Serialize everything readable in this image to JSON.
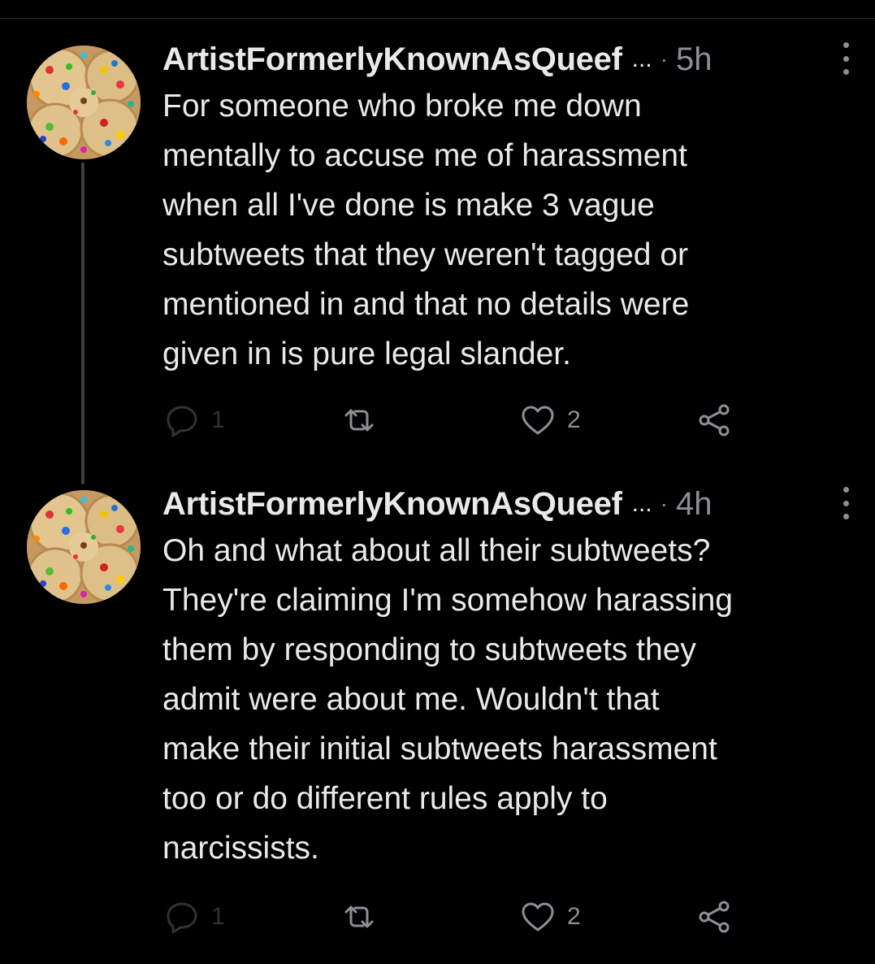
{
  "tweets": [
    {
      "author": "ArtistFormerlyKnownAsQueef",
      "ellipsis": "...",
      "separator": "·",
      "time": "5h",
      "lines": [
        "For someone who broke me down",
        "mentally to accuse me of harassment",
        "when all I've done is make 3 vague",
        "subtweets that they weren't tagged or",
        "mentioned in and that no details were",
        "given in is pure legal slander."
      ],
      "reply_count": "1",
      "like_count": "2"
    },
    {
      "author": "ArtistFormerlyKnownAsQueef",
      "ellipsis": "...",
      "separator": "·",
      "time": "4h",
      "lines": [
        "Oh and what about all their subtweets?",
        "They're claiming I'm somehow harassing",
        "them by responding to subtweets they",
        "admit were about me. Wouldn't that",
        "make their initial subtweets harassment",
        "too or do different rules apply to",
        "narcissists."
      ],
      "reply_count": "1",
      "like_count": "2"
    }
  ],
  "icons": {
    "reply": "reply-icon",
    "retweet": "retweet-icon",
    "like": "heart-icon",
    "share": "share-icon",
    "more": "more-vertical-icon"
  },
  "colors": {
    "background": "#000000",
    "text": "#e7e9ea",
    "muted": "#8b9096",
    "thread_line": "#3b4045"
  }
}
